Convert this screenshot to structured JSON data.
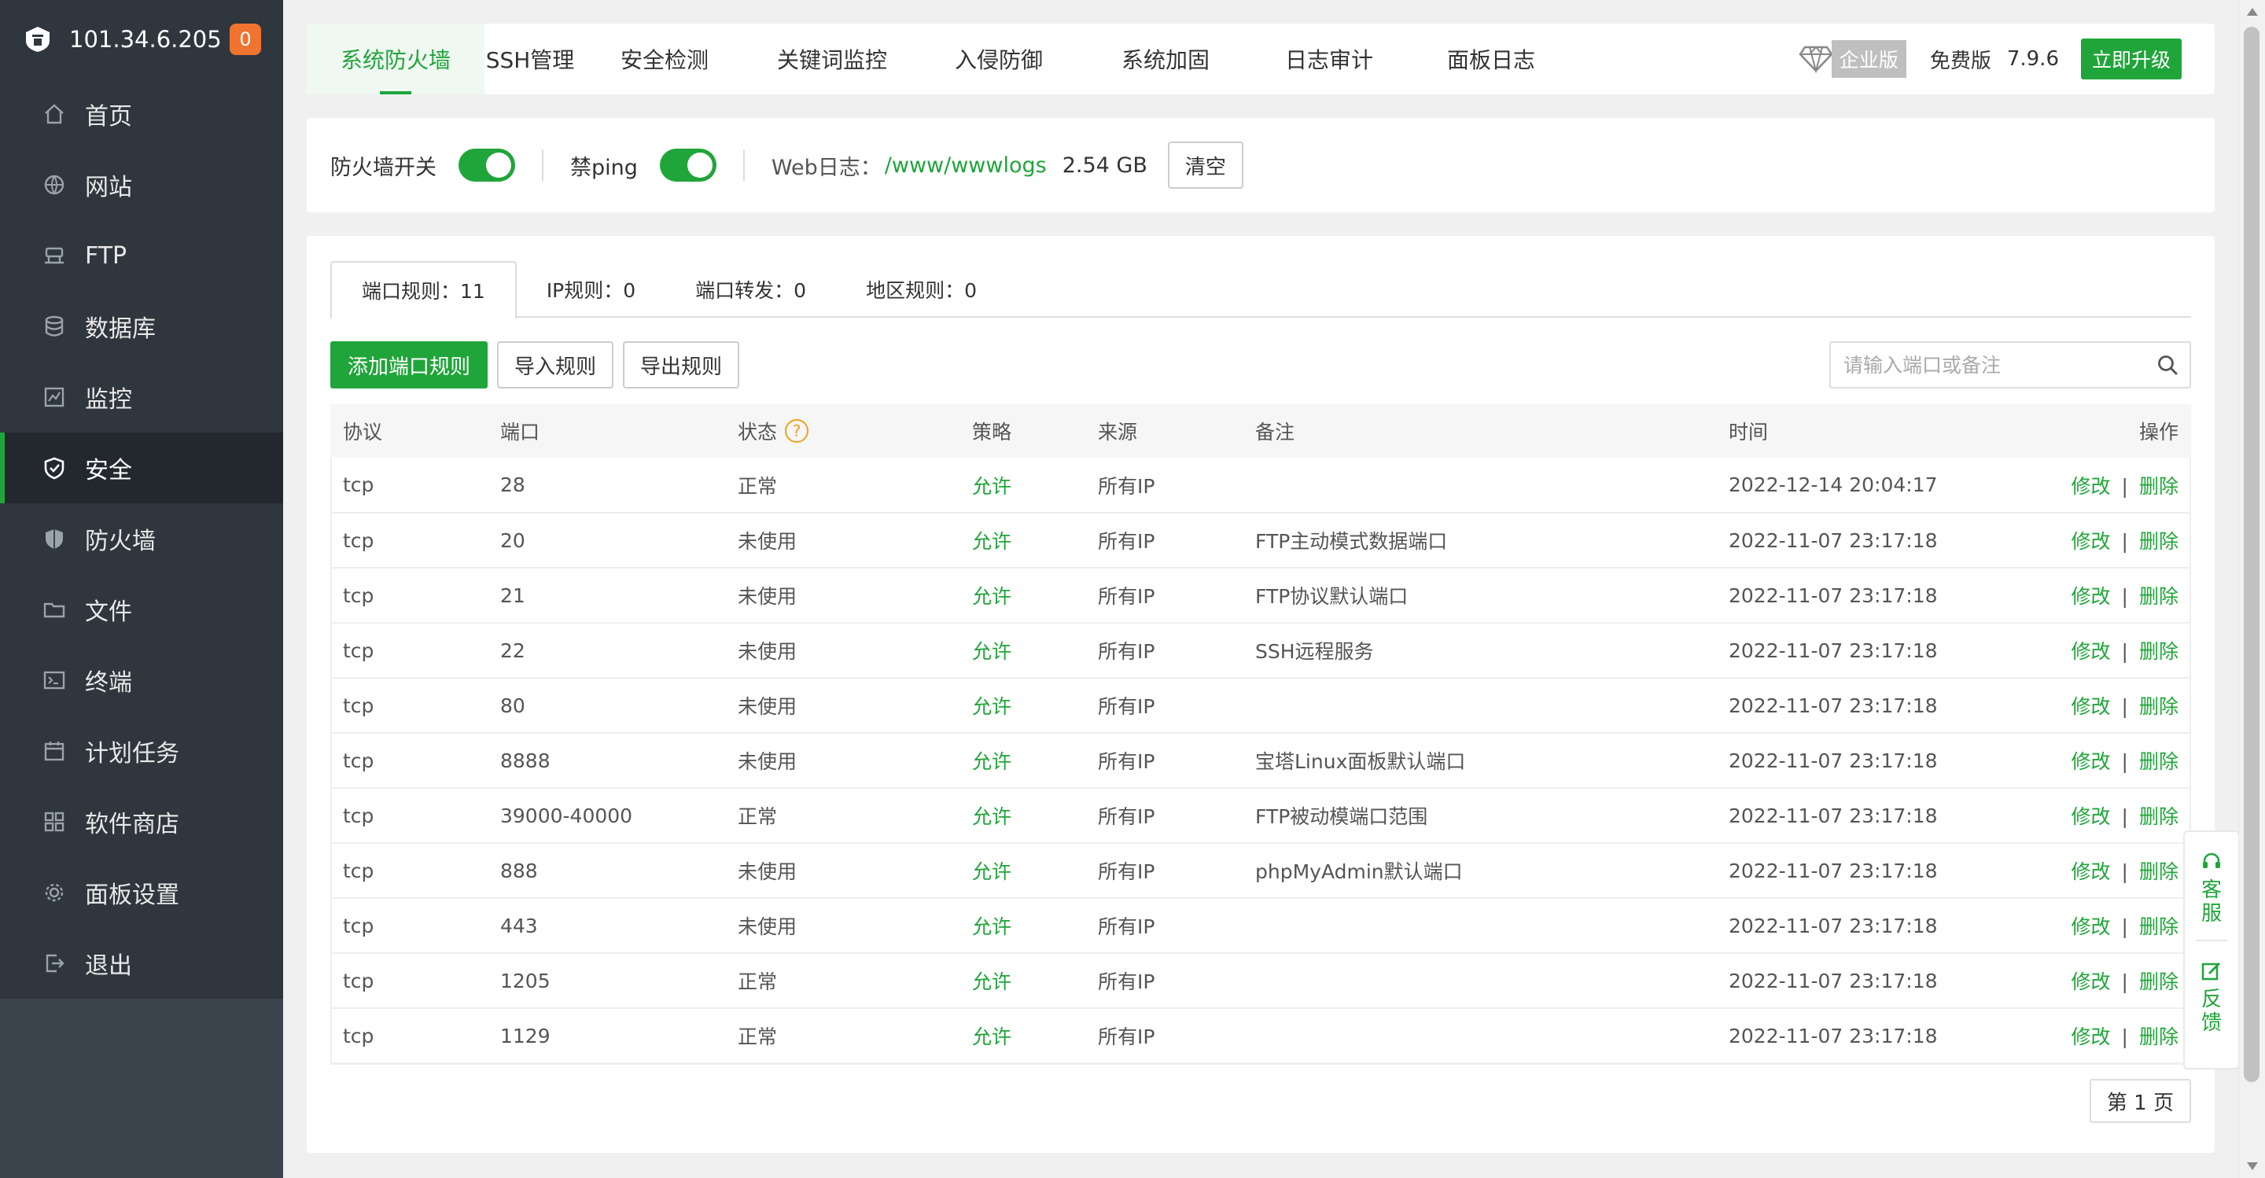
{
  "server": {
    "ip": "101.34.6.205",
    "badge": "0"
  },
  "sidebar": {
    "items": [
      {
        "label": "首页",
        "icon": "home-icon"
      },
      {
        "label": "网站",
        "icon": "globe-icon"
      },
      {
        "label": "FTP",
        "icon": "ftp-icon"
      },
      {
        "label": "数据库",
        "icon": "database-icon"
      },
      {
        "label": "监控",
        "icon": "monitor-icon"
      },
      {
        "label": "安全",
        "icon": "shield-icon",
        "active": true
      },
      {
        "label": "防火墙",
        "icon": "firewall-icon"
      },
      {
        "label": "文件",
        "icon": "folder-icon"
      },
      {
        "label": "终端",
        "icon": "terminal-icon"
      },
      {
        "label": "计划任务",
        "icon": "calendar-icon"
      },
      {
        "label": "软件商店",
        "icon": "apps-icon"
      },
      {
        "label": "面板设置",
        "icon": "gear-icon"
      },
      {
        "label": "退出",
        "icon": "logout-icon"
      }
    ]
  },
  "topnav": {
    "tabs": [
      "系统防火墙",
      "SSH管理",
      "安全检测",
      "关键词监控",
      "入侵防御",
      "系统加固",
      "日志审计",
      "面板日志"
    ],
    "enterprise": "企业版",
    "free": "免费版",
    "version": "7.9.6",
    "upgrade": "立即升级"
  },
  "togglebar": {
    "firewall_label": "防火墙开关",
    "ping_label": "禁ping",
    "weblog_label": "Web日志：",
    "weblog_path": "/www/wwwlogs",
    "weblog_size": "2.54 GB",
    "clear": "清空"
  },
  "subtabs": [
    "端口规则：11",
    "IP规则：0",
    "端口转发：0",
    "地区规则：0"
  ],
  "actions": {
    "add": "添加端口规则",
    "import": "导入规则",
    "export": "导出规则"
  },
  "search": {
    "placeholder": "请输入端口或备注"
  },
  "table": {
    "headers": [
      "协议",
      "端口",
      "状态",
      "策略",
      "来源",
      "备注",
      "时间",
      "操作"
    ],
    "edit": "修改",
    "sep": "|",
    "delete": "删除",
    "rows": [
      {
        "protocol": "tcp",
        "port": "28",
        "status": "正常",
        "policy": "允许",
        "source": "所有IP",
        "note": "",
        "time": "2022-12-14 20:04:17"
      },
      {
        "protocol": "tcp",
        "port": "20",
        "status": "未使用",
        "policy": "允许",
        "source": "所有IP",
        "note": "FTP主动模式数据端口",
        "time": "2022-11-07 23:17:18"
      },
      {
        "protocol": "tcp",
        "port": "21",
        "status": "未使用",
        "policy": "允许",
        "source": "所有IP",
        "note": "FTP协议默认端口",
        "time": "2022-11-07 23:17:18"
      },
      {
        "protocol": "tcp",
        "port": "22",
        "status": "未使用",
        "policy": "允许",
        "source": "所有IP",
        "note": "SSH远程服务",
        "time": "2022-11-07 23:17:18"
      },
      {
        "protocol": "tcp",
        "port": "80",
        "status": "未使用",
        "policy": "允许",
        "source": "所有IP",
        "note": "",
        "time": "2022-11-07 23:17:18"
      },
      {
        "protocol": "tcp",
        "port": "8888",
        "status": "未使用",
        "policy": "允许",
        "source": "所有IP",
        "note": "宝塔Linux面板默认端口",
        "time": "2022-11-07 23:17:18"
      },
      {
        "protocol": "tcp",
        "port": "39000-40000",
        "status": "正常",
        "policy": "允许",
        "source": "所有IP",
        "note": "FTP被动模端口范围",
        "time": "2022-11-07 23:17:18"
      },
      {
        "protocol": "tcp",
        "port": "888",
        "status": "未使用",
        "policy": "允许",
        "source": "所有IP",
        "note": "phpMyAdmin默认端口",
        "time": "2022-11-07 23:17:18"
      },
      {
        "protocol": "tcp",
        "port": "443",
        "status": "未使用",
        "policy": "允许",
        "source": "所有IP",
        "note": "",
        "time": "2022-11-07 23:17:18"
      },
      {
        "protocol": "tcp",
        "port": "1205",
        "status": "正常",
        "policy": "允许",
        "source": "所有IP",
        "note": "",
        "time": "2022-11-07 23:17:18"
      },
      {
        "protocol": "tcp",
        "port": "1129",
        "status": "正常",
        "policy": "允许",
        "source": "所有IP",
        "note": "",
        "time": "2022-11-07 23:17:18"
      }
    ]
  },
  "pager": {
    "label": "第 1 页"
  },
  "float": {
    "service": "客服",
    "feedback": "反馈"
  },
  "colors": {
    "accent": "#20a53a",
    "sidebar": "#3c444d",
    "badge": "#f0732f"
  }
}
